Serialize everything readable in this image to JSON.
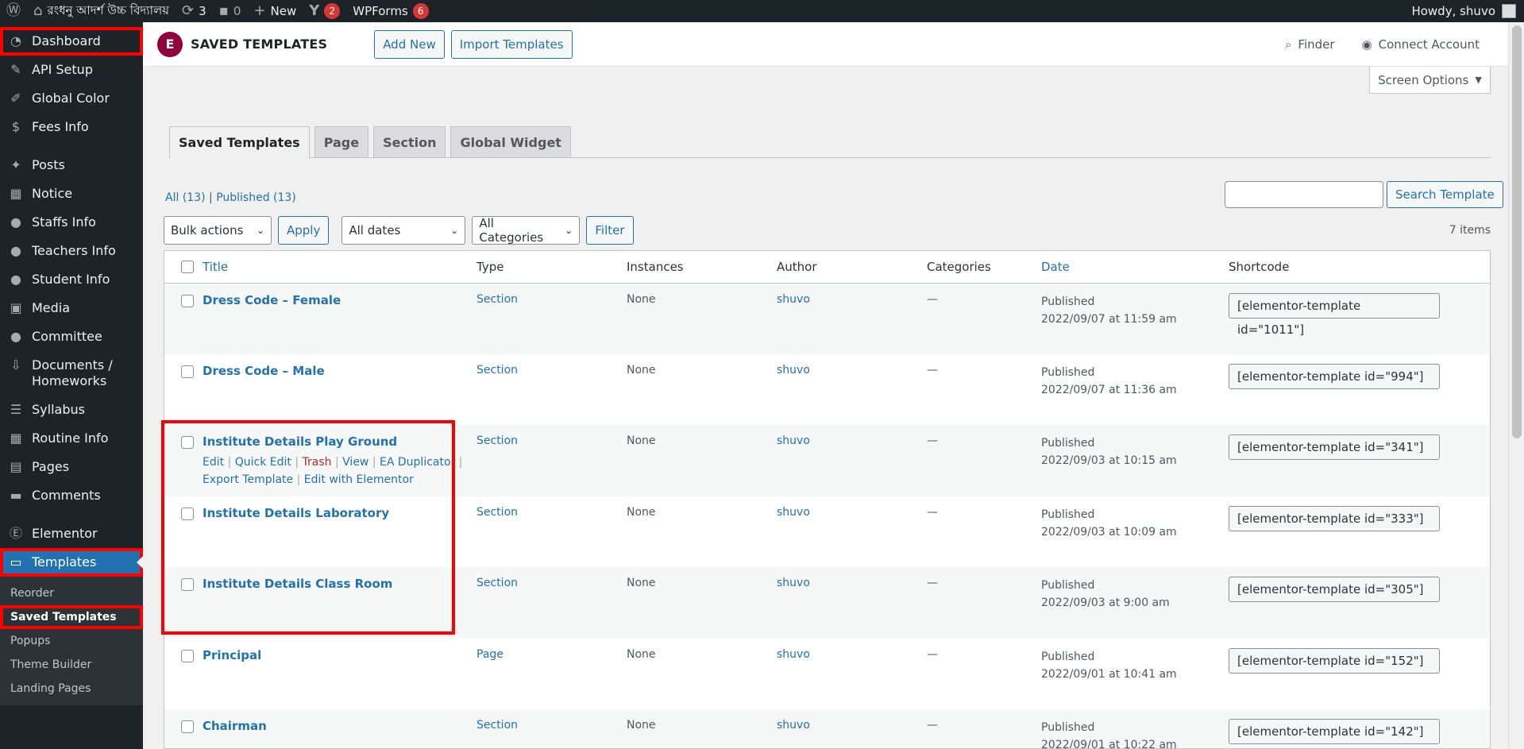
{
  "adminbar": {
    "site_name": "রংধনু আদর্শ উচ্চ বিদ্যালয়",
    "updates_count": "3",
    "comments_count": "0",
    "new_label": "New",
    "yoast_badge": "2",
    "wpforms_label": "WPForms",
    "wpforms_badge": "6",
    "howdy": "Howdy, shuvo"
  },
  "sidebar": {
    "items": [
      {
        "label": "Dashboard",
        "icon": "dashboard-icon"
      },
      {
        "label": "API Setup",
        "icon": "tools-icon"
      },
      {
        "label": "Global Color",
        "icon": "brush-icon"
      },
      {
        "label": "Fees Info",
        "icon": "money-icon"
      },
      {
        "label": "Posts",
        "icon": "pin-icon"
      },
      {
        "label": "Notice",
        "icon": "calendar-icon"
      },
      {
        "label": "Staffs Info",
        "icon": "users-icon"
      },
      {
        "label": "Teachers Info",
        "icon": "users-icon"
      },
      {
        "label": "Student Info",
        "icon": "users-icon"
      },
      {
        "label": "Media",
        "icon": "media-icon"
      },
      {
        "label": "Committee",
        "icon": "users-icon"
      },
      {
        "label": "Documents / Homeworks",
        "icon": "download-icon"
      },
      {
        "label": "Syllabus",
        "icon": "list-icon"
      },
      {
        "label": "Routine Info",
        "icon": "calendar-icon"
      },
      {
        "label": "Pages",
        "icon": "page-icon"
      },
      {
        "label": "Comments",
        "icon": "comment-icon"
      },
      {
        "label": "Elementor",
        "icon": "elementor-icon"
      },
      {
        "label": "Templates",
        "icon": "folder-icon"
      }
    ],
    "submenu": [
      "Reorder",
      "Saved Templates",
      "Popups",
      "Theme Builder",
      "Landing Pages"
    ]
  },
  "header": {
    "logo_letter": "E",
    "title": "SAVED TEMPLATES",
    "add_new": "Add New",
    "import": "Import Templates",
    "finder": "Finder",
    "connect": "Connect Account",
    "screen_options": "Screen Options"
  },
  "tabs": [
    "Saved Templates",
    "Page",
    "Section",
    "Global Widget"
  ],
  "subsub": {
    "all": "All",
    "all_count": "(13)",
    "published": "Published",
    "published_count": "(13)"
  },
  "search": {
    "button": "Search Template",
    "value": ""
  },
  "actions": {
    "bulk": "Bulk actions",
    "apply": "Apply",
    "dates": "All dates",
    "categories": "All Categories",
    "filter": "Filter",
    "items_count": "7 items"
  },
  "table": {
    "columns": [
      "Title",
      "Type",
      "Instances",
      "Author",
      "Categories",
      "Date",
      "Shortcode"
    ],
    "row_actions": {
      "edit": "Edit",
      "quick_edit": "Quick Edit",
      "trash": "Trash",
      "view": "View",
      "duplicator": "EA Duplicator",
      "export": "Export Template",
      "edit_elementor": "Edit with Elementor"
    },
    "rows": [
      {
        "title": "Dress Code – Female",
        "type": "Section",
        "instances": "None",
        "author": "shuvo",
        "categories": "—",
        "status": "Published",
        "date": "2022/09/07 at 11:59 am",
        "shortcode": "[elementor-template id=\"1011\"]"
      },
      {
        "title": "Dress Code – Male",
        "type": "Section",
        "instances": "None",
        "author": "shuvo",
        "categories": "—",
        "status": "Published",
        "date": "2022/09/07 at 11:36 am",
        "shortcode": "[elementor-template id=\"994\"]"
      },
      {
        "title": "Institute Details Play Ground",
        "type": "Section",
        "instances": "None",
        "author": "shuvo",
        "categories": "—",
        "status": "Published",
        "date": "2022/09/03 at 10:15 am",
        "shortcode": "[elementor-template id=\"341\"]"
      },
      {
        "title": "Institute Details Laboratory",
        "type": "Section",
        "instances": "None",
        "author": "shuvo",
        "categories": "—",
        "status": "Published",
        "date": "2022/09/03 at 10:09 am",
        "shortcode": "[elementor-template id=\"333\"]"
      },
      {
        "title": "Institute Details Class Room",
        "type": "Section",
        "instances": "None",
        "author": "shuvo",
        "categories": "—",
        "status": "Published",
        "date": "2022/09/03 at 9:00 am",
        "shortcode": "[elementor-template id=\"305\"]"
      },
      {
        "title": "Principal",
        "type": "Page",
        "instances": "None",
        "author": "shuvo",
        "categories": "—",
        "status": "Published",
        "date": "2022/09/01 at 10:41 am",
        "shortcode": "[elementor-template id=\"152\"]"
      },
      {
        "title": "Chairman",
        "type": "Section",
        "instances": "None",
        "author": "shuvo",
        "categories": "—",
        "status": "Published",
        "date": "2022/09/01 at 10:22 am",
        "shortcode": "[elementor-template id=\"142\"]"
      }
    ]
  },
  "colors": {
    "accent": "#2271b1",
    "admin_dark": "#1d2327",
    "highlight": "#ff0000",
    "elementor": "#92003b"
  }
}
